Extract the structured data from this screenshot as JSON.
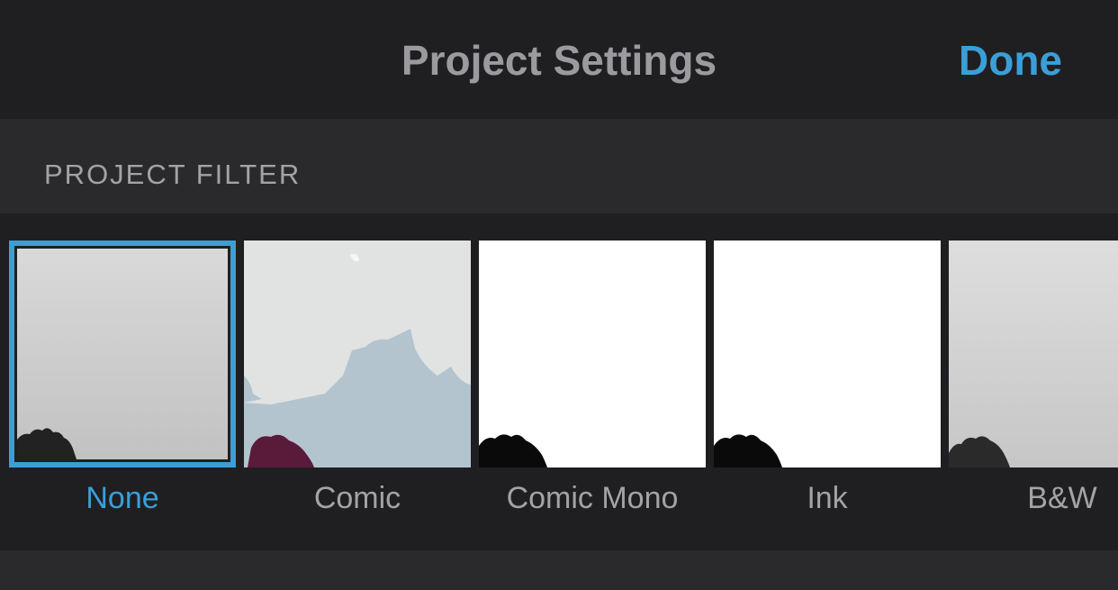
{
  "nav": {
    "title": "Project Settings",
    "done_label": "Done"
  },
  "section": {
    "label": "PROJECT FILTER"
  },
  "filters": [
    {
      "label": "None",
      "selected": true
    },
    {
      "label": "Comic",
      "selected": false
    },
    {
      "label": "Comic Mono",
      "selected": false
    },
    {
      "label": "Ink",
      "selected": false
    },
    {
      "label": "B&W",
      "selected": false
    }
  ],
  "colors": {
    "accent": "#3a9fd8",
    "nav_background": "#1f1f21",
    "section_background": "#2a2a2c",
    "secondary_text": "#a3a3a7"
  }
}
